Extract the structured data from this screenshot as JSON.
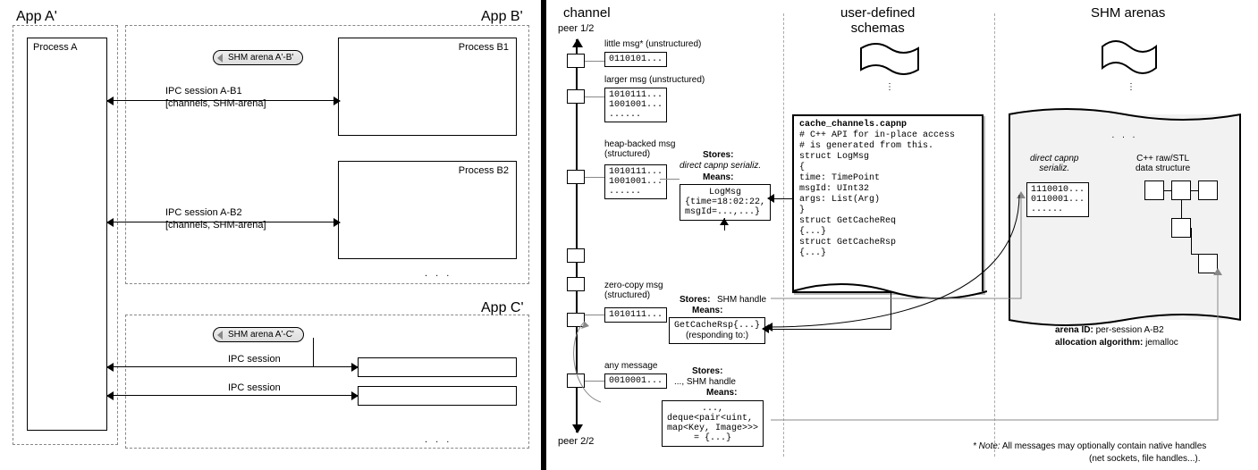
{
  "left": {
    "appA": "App A'",
    "appB": "App B'",
    "appC": "App C'",
    "procA": "Process A",
    "procB1": "Process B1",
    "procB2": "Process B2",
    "arenaAB": "SHM arena A'-B'",
    "arenaAC": "SHM arena A'-C'",
    "sessAB1a": "IPC session A-B1",
    "sessAB1b": "[channels, SHM-arena]",
    "sessAB2a": "IPC session A-B2",
    "sessAB2b": "[channels, SHM-arena]",
    "sessC1": "IPC session",
    "sessC2": "IPC session",
    "dots": ". . .",
    "dots2": ". . ."
  },
  "right": {
    "col_channel": "channel",
    "col_schemas": "user-defined\nschemas",
    "col_arenas": "SHM arenas",
    "peer12": "peer 1/2",
    "peer22": "peer 2/2",
    "m1_t": "little msg* (unstructured)",
    "m1_d": "0110101...",
    "m2_t": "larger msg (unstructured)",
    "m2_d1": "1010111...",
    "m2_d2": "1001001...",
    "m2_d3": "......",
    "m3_t": "heap-backed msg\n(structured)",
    "m3_d1": "1010111...",
    "m3_d2": "1001001...",
    "m3_d3": "......",
    "stores": "Stores:",
    "means": "Means:",
    "m3_stores": "direct capnp serializ.",
    "m3_means1": "LogMsg",
    "m3_means2": "{time=18:02:22,",
    "m3_means3": "msgId=...,...}",
    "m4_t": "zero-copy msg\n(structured)",
    "m4_d": "1010111...",
    "m4_stores": "SHM handle",
    "m4_means1": "GetCacheRsp{...}",
    "m4_means2": "(responding to:)",
    "m5_t": "any message",
    "m5_d": "0010001...",
    "m5_stores": "..., SHM handle",
    "m5_means1": "...,",
    "m5_means2": "deque<pair<uint,",
    "m5_means3": "map<Key, Image>>>",
    "m5_means4": "= {...}",
    "schema_file": "cache_channels.capnp",
    "schema_l1": "# C++ API for in-place access",
    "schema_l2": "# is generated from this.",
    "schema_l3": "struct LogMsg",
    "schema_l4": "{",
    "schema_l5": "  time: TimePoint",
    "schema_l6": "  msgId: UInt32",
    "schema_l7": "  args: List(Arg)",
    "schema_l8": "}",
    "schema_l9": "struct GetCacheReq",
    "schema_l10": "{...}",
    "schema_l11": "struct GetCacheRsp",
    "schema_l12": "{...}",
    "arena_col1": "direct capnp\nserializ.",
    "arena_col2": "C++ raw/STL\ndata structure",
    "arena_d1": "1110010...",
    "arena_d2": "0110001...",
    "arena_d3": "......",
    "arena_dots": ". . .",
    "arena_id_l": "arena ID:",
    "arena_id_v": "per-session A-B2",
    "arena_alg_l": "allocation algorithm:",
    "arena_alg_v": "jemalloc",
    "note_l": "* Note:",
    "note_v1": "All messages may optionally contain native handles",
    "note_v2": "(net sockets, file handles...)."
  }
}
